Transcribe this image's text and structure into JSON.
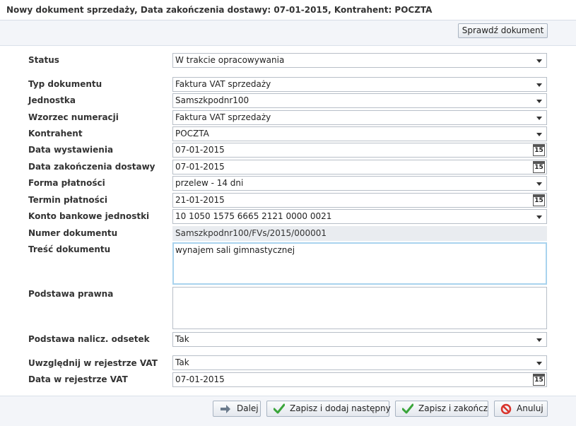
{
  "window": {
    "title": "Nowy dokument sprzedaży, Data zakończenia dostawy: 07-01-2015, Kontrahent: POCZTA"
  },
  "toolbar": {
    "check_label": "Sprawdź dokument"
  },
  "form": {
    "status": {
      "label": "Status",
      "value": "W trakcie opracowywania"
    },
    "doc_type": {
      "label": "Typ dokumentu",
      "value": "Faktura VAT sprzedaży"
    },
    "unit": {
      "label": "Jednostka",
      "value": "Samszkpodnr100"
    },
    "numbering": {
      "label": "Wzorzec numeracji",
      "value": "Faktura VAT sprzedaży"
    },
    "contractor": {
      "label": "Kontrahent",
      "value": "POCZTA"
    },
    "issue_date": {
      "label": "Data wystawienia",
      "value": "07-01-2015",
      "cal": "15"
    },
    "delivery_end": {
      "label": "Data zakończenia dostawy",
      "value": "07-01-2015",
      "cal": "15"
    },
    "payment_form": {
      "label": "Forma płatności",
      "value": "przelew - 14 dni"
    },
    "payment_due": {
      "label": "Termin płatności",
      "value": "21-01-2015",
      "cal": "15"
    },
    "bank_account": {
      "label": "Konto bankowe jednostki",
      "value": "10 1050 1575 6665 2121 0000 0021"
    },
    "doc_number": {
      "label": "Numer dokumentu",
      "value": "Samszkpodnr100/FVs/2015/000001"
    },
    "content": {
      "label": "Treść dokumentu",
      "value": "wynajem sali gimnastycznej"
    },
    "legal_basis": {
      "label": "Podstawa prawna",
      "value": ""
    },
    "interest_basis": {
      "label": "Podstawa nalicz. odsetek",
      "value": "Tak"
    },
    "vat_register": {
      "label": "Uwzględnij w rejestrze VAT",
      "value": "Tak"
    },
    "vat_register_date": {
      "label": "Data w rejestrze VAT",
      "value": "07-01-2015",
      "cal": "15"
    }
  },
  "footer": {
    "next_label": "Dalej",
    "save_add_label": "Zapisz i dodaj następny",
    "save_finish_label": "Zapisz i zakończ",
    "cancel_label": "Anuluj"
  },
  "colors": {
    "accent_green": "#3aa53a",
    "cancel_red": "#d9332b",
    "arrow_grey": "#6b7b8c"
  }
}
